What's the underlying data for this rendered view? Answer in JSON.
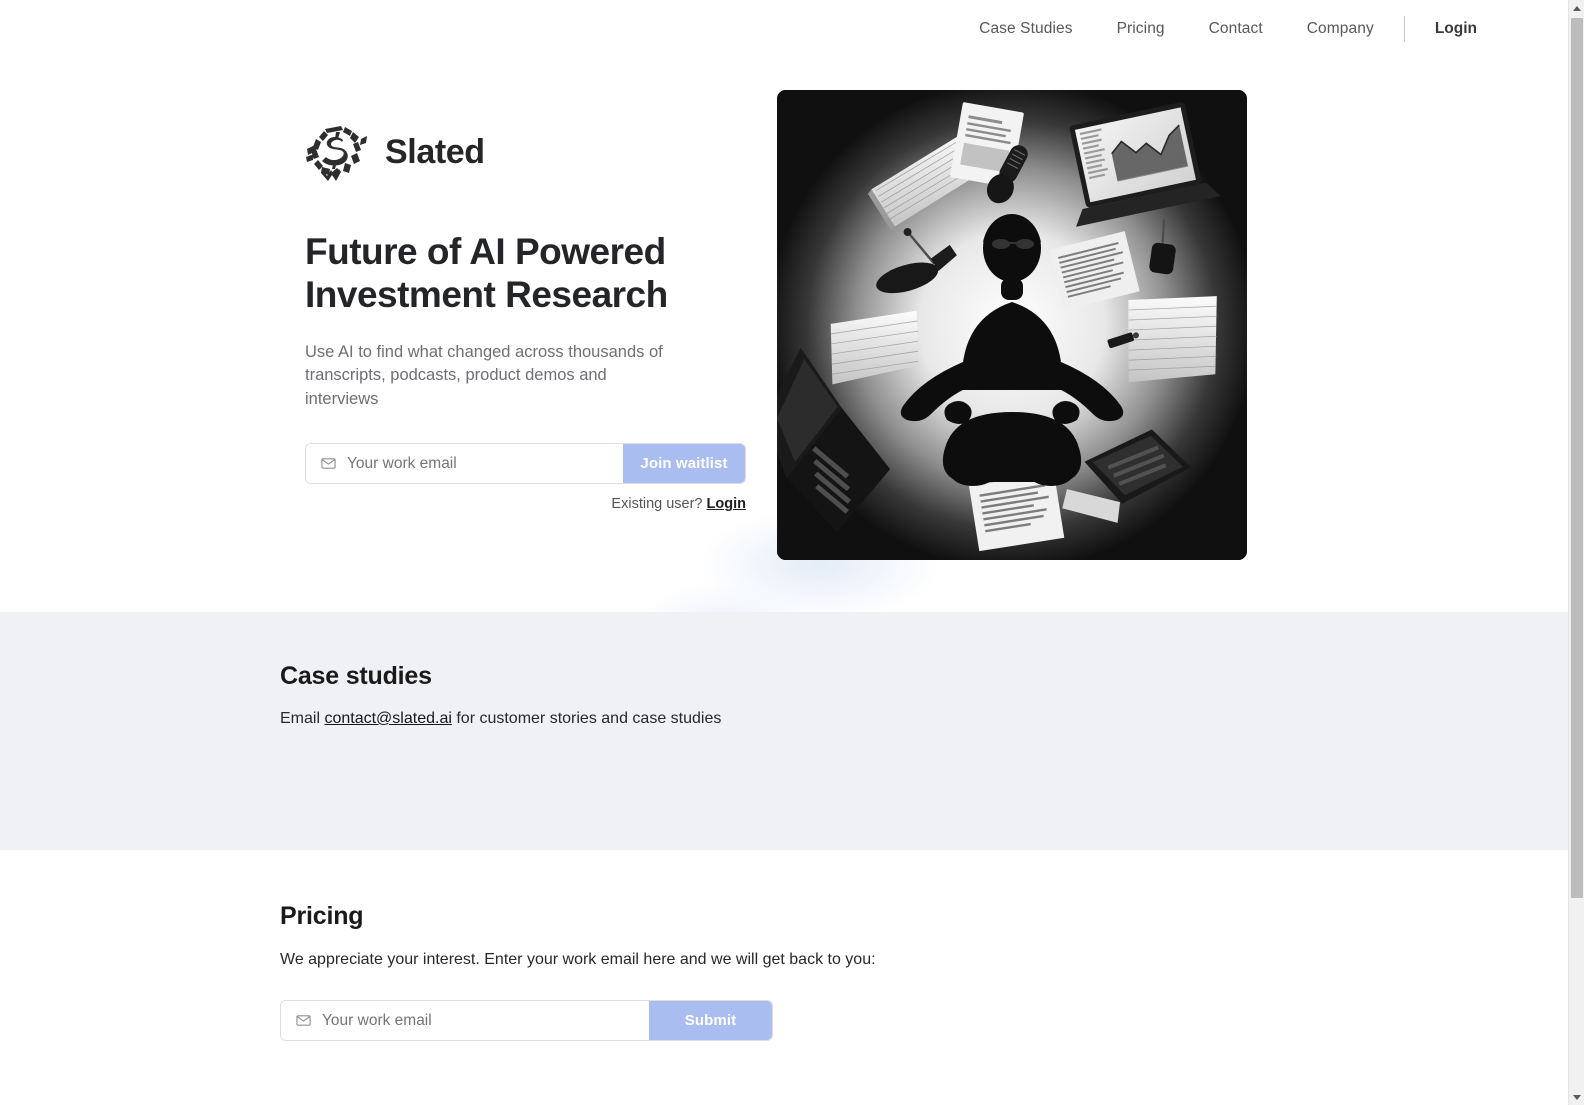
{
  "nav": {
    "links": [
      {
        "label": "Case Studies"
      },
      {
        "label": "Pricing"
      },
      {
        "label": "Contact"
      },
      {
        "label": "Company"
      }
    ],
    "login_label": "Login"
  },
  "brand": {
    "name": "Slated",
    "mark_icon": "slated-brushstroke-s-logo"
  },
  "hero": {
    "headline": "Future of AI Powered Investment Research",
    "subhead": "Use AI to find what changed across thousands of transcripts, podcasts, product demos and interviews",
    "form": {
      "placeholder": "Your work email",
      "value": "",
      "button_label": "Join waitlist",
      "icon": "envelope-icon"
    },
    "existing_user_text": "Existing user?",
    "existing_user_link": "Login",
    "image_alt": "Silhouette of a person meditating in lotus pose surrounded by floating stacks of paper, documents, laptops and microphones, black and white"
  },
  "case_studies": {
    "title": "Case studies",
    "body_prefix": "Email",
    "email": "contact@slated.ai",
    "body_suffix": "for customer stories and case studies"
  },
  "pricing": {
    "title": "Pricing",
    "body": "We appreciate your interest. Enter your work email here and we will get back to you:",
    "form": {
      "placeholder": "Your work email",
      "value": "",
      "button_label": "Submit",
      "icon": "envelope-icon"
    }
  },
  "colors": {
    "accent": "#aabdf0",
    "band_background": "#f0f1f5",
    "page_background": "#ffffff",
    "heading": "#242528",
    "muted_text": "#6d6f74"
  },
  "scrollbar": {
    "up_icon": "scroll-up-arrow-icon",
    "down_icon": "scroll-down-arrow-icon"
  }
}
